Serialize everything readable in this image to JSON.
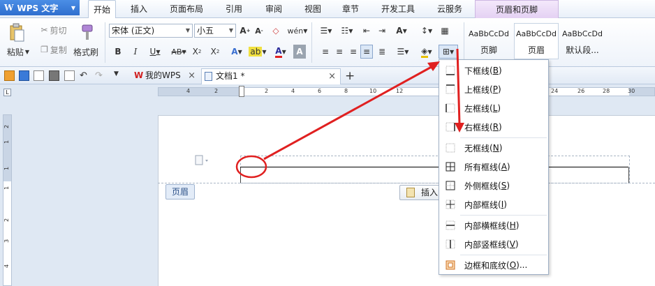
{
  "app": {
    "logo_text": "WPS 文字"
  },
  "tabs": [
    {
      "label": "开始"
    },
    {
      "label": "插入"
    },
    {
      "label": "页面布局"
    },
    {
      "label": "引用"
    },
    {
      "label": "审阅"
    },
    {
      "label": "视图"
    },
    {
      "label": "章节"
    },
    {
      "label": "开发工具"
    },
    {
      "label": "云服务"
    },
    {
      "label": "页眉和页脚"
    }
  ],
  "ribbon": {
    "paste_label": "粘贴",
    "cut_label": "剪切",
    "copy_label": "复制",
    "format_painter_label": "格式刷",
    "font_name": "宋体 (正文)",
    "font_size": "小五",
    "styles": [
      {
        "sample": "AaBbCcDd",
        "name": "页脚"
      },
      {
        "sample": "AaBbCcDd",
        "name": "页眉"
      },
      {
        "sample": "AaBbCcDd",
        "name": "默认段..."
      }
    ]
  },
  "doc_tabs": [
    {
      "label": "我的WPS"
    },
    {
      "label": "文档1 *"
    }
  ],
  "ruler": {
    "h_labels": [
      "4",
      "2",
      "2",
      "4",
      "6",
      "8",
      "10",
      "12",
      "24",
      "26",
      "28",
      "30"
    ],
    "v_labels": [
      "2",
      "1",
      "1",
      "1",
      "2",
      "3",
      "4"
    ]
  },
  "page": {
    "header_badge": "页眉",
    "insert_badge": "插入"
  },
  "border_menu": {
    "items": [
      {
        "label": "下框线",
        "key": "B"
      },
      {
        "label": "上框线",
        "key": "P"
      },
      {
        "label": "左框线",
        "key": "L"
      },
      {
        "label": "右框线",
        "key": "R"
      },
      {
        "label": "无框线",
        "key": "N"
      },
      {
        "label": "所有框线",
        "key": "A"
      },
      {
        "label": "外侧框线",
        "key": "S"
      },
      {
        "label": "内部框线",
        "key": "I"
      },
      {
        "label": "内部横框线",
        "key": "H"
      },
      {
        "label": "内部竖框线",
        "key": "V"
      },
      {
        "label": "边框和底纹",
        "key": "O",
        "suffix": "..."
      }
    ]
  },
  "colors": {
    "accent": "#2f6fce",
    "annotation": "#e02020",
    "context_tab": "#e4d1f3"
  }
}
